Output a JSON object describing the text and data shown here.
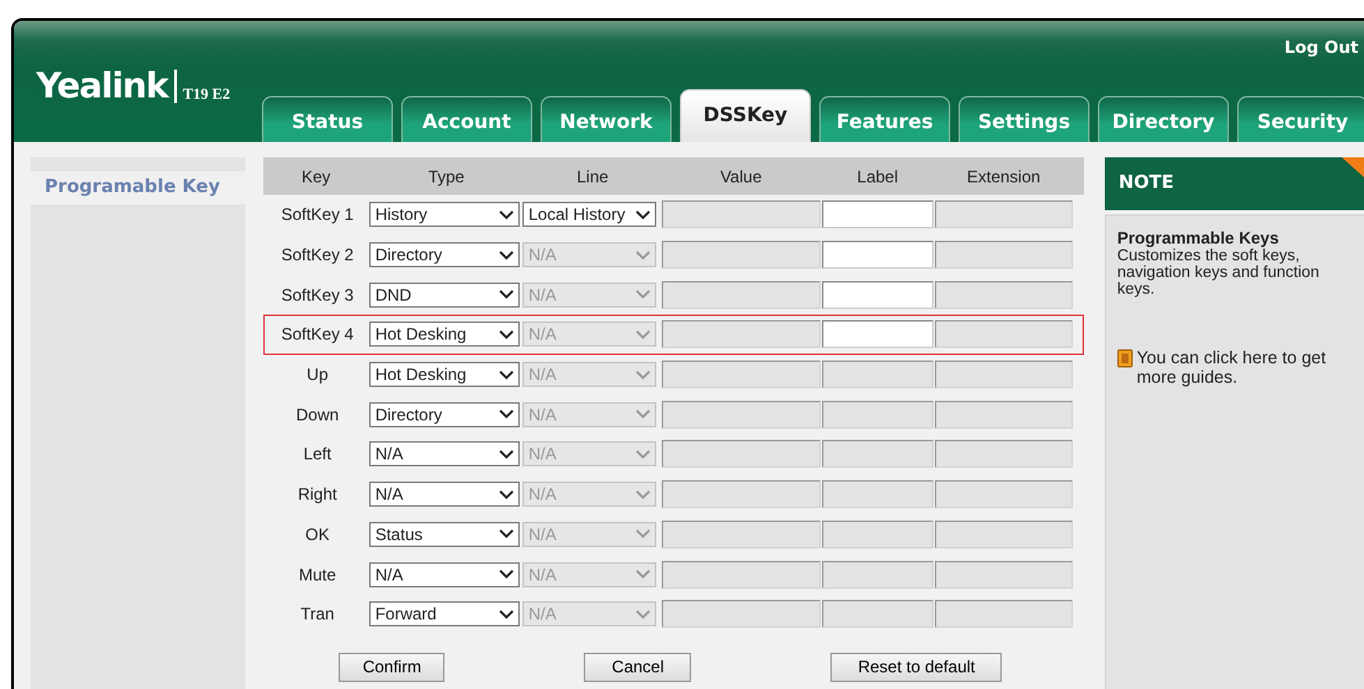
{
  "header": {
    "logo": "Yealink",
    "model": "T19 E2",
    "logout": "Log Out"
  },
  "tabs": [
    {
      "label": "Status",
      "selected": false
    },
    {
      "label": "Account",
      "selected": false
    },
    {
      "label": "Network",
      "selected": false
    },
    {
      "label": "DSSKey",
      "selected": true
    },
    {
      "label": "Features",
      "selected": false
    },
    {
      "label": "Settings",
      "selected": false
    },
    {
      "label": "Directory",
      "selected": false
    },
    {
      "label": "Security",
      "selected": false
    }
  ],
  "sidebar": {
    "items": [
      {
        "label": "Programable Key",
        "selected": true
      }
    ]
  },
  "table": {
    "columns": [
      "Key",
      "Type",
      "Line",
      "Value",
      "Label",
      "Extension"
    ],
    "rows": [
      {
        "key": "SoftKey 1",
        "type": "History",
        "line": "Local History",
        "line_disabled": false,
        "label_disabled": false,
        "highlighted": false
      },
      {
        "key": "SoftKey 2",
        "type": "Directory",
        "line": "N/A",
        "line_disabled": true,
        "label_disabled": false,
        "highlighted": false
      },
      {
        "key": "SoftKey 3",
        "type": "DND",
        "line": "N/A",
        "line_disabled": true,
        "label_disabled": false,
        "highlighted": false
      },
      {
        "key": "SoftKey 4",
        "type": "Hot Desking",
        "line": "N/A",
        "line_disabled": true,
        "label_disabled": false,
        "highlighted": true
      },
      {
        "key": "Up",
        "type": "Hot Desking",
        "line": "N/A",
        "line_disabled": true,
        "label_disabled": true,
        "highlighted": false
      },
      {
        "key": "Down",
        "type": "Directory",
        "line": "N/A",
        "line_disabled": true,
        "label_disabled": true,
        "highlighted": false
      },
      {
        "key": "Left",
        "type": "N/A",
        "line": "N/A",
        "line_disabled": true,
        "label_disabled": true,
        "highlighted": false
      },
      {
        "key": "Right",
        "type": "N/A",
        "line": "N/A",
        "line_disabled": true,
        "label_disabled": true,
        "highlighted": false
      },
      {
        "key": "OK",
        "type": "Status",
        "line": "N/A",
        "line_disabled": true,
        "label_disabled": true,
        "highlighted": false
      },
      {
        "key": "Mute",
        "type": "N/A",
        "line": "N/A",
        "line_disabled": true,
        "label_disabled": true,
        "highlighted": false
      },
      {
        "key": "Tran",
        "type": "Forward",
        "line": "N/A",
        "line_disabled": true,
        "label_disabled": true,
        "highlighted": false
      }
    ]
  },
  "buttons": [
    "Confirm",
    "Cancel",
    "Reset to default"
  ],
  "note": {
    "title": "NOTE",
    "heading": "Programmable Keys",
    "text": "Customizes the soft keys, navigation keys and function keys.",
    "link": "You can click here to get more guides."
  }
}
